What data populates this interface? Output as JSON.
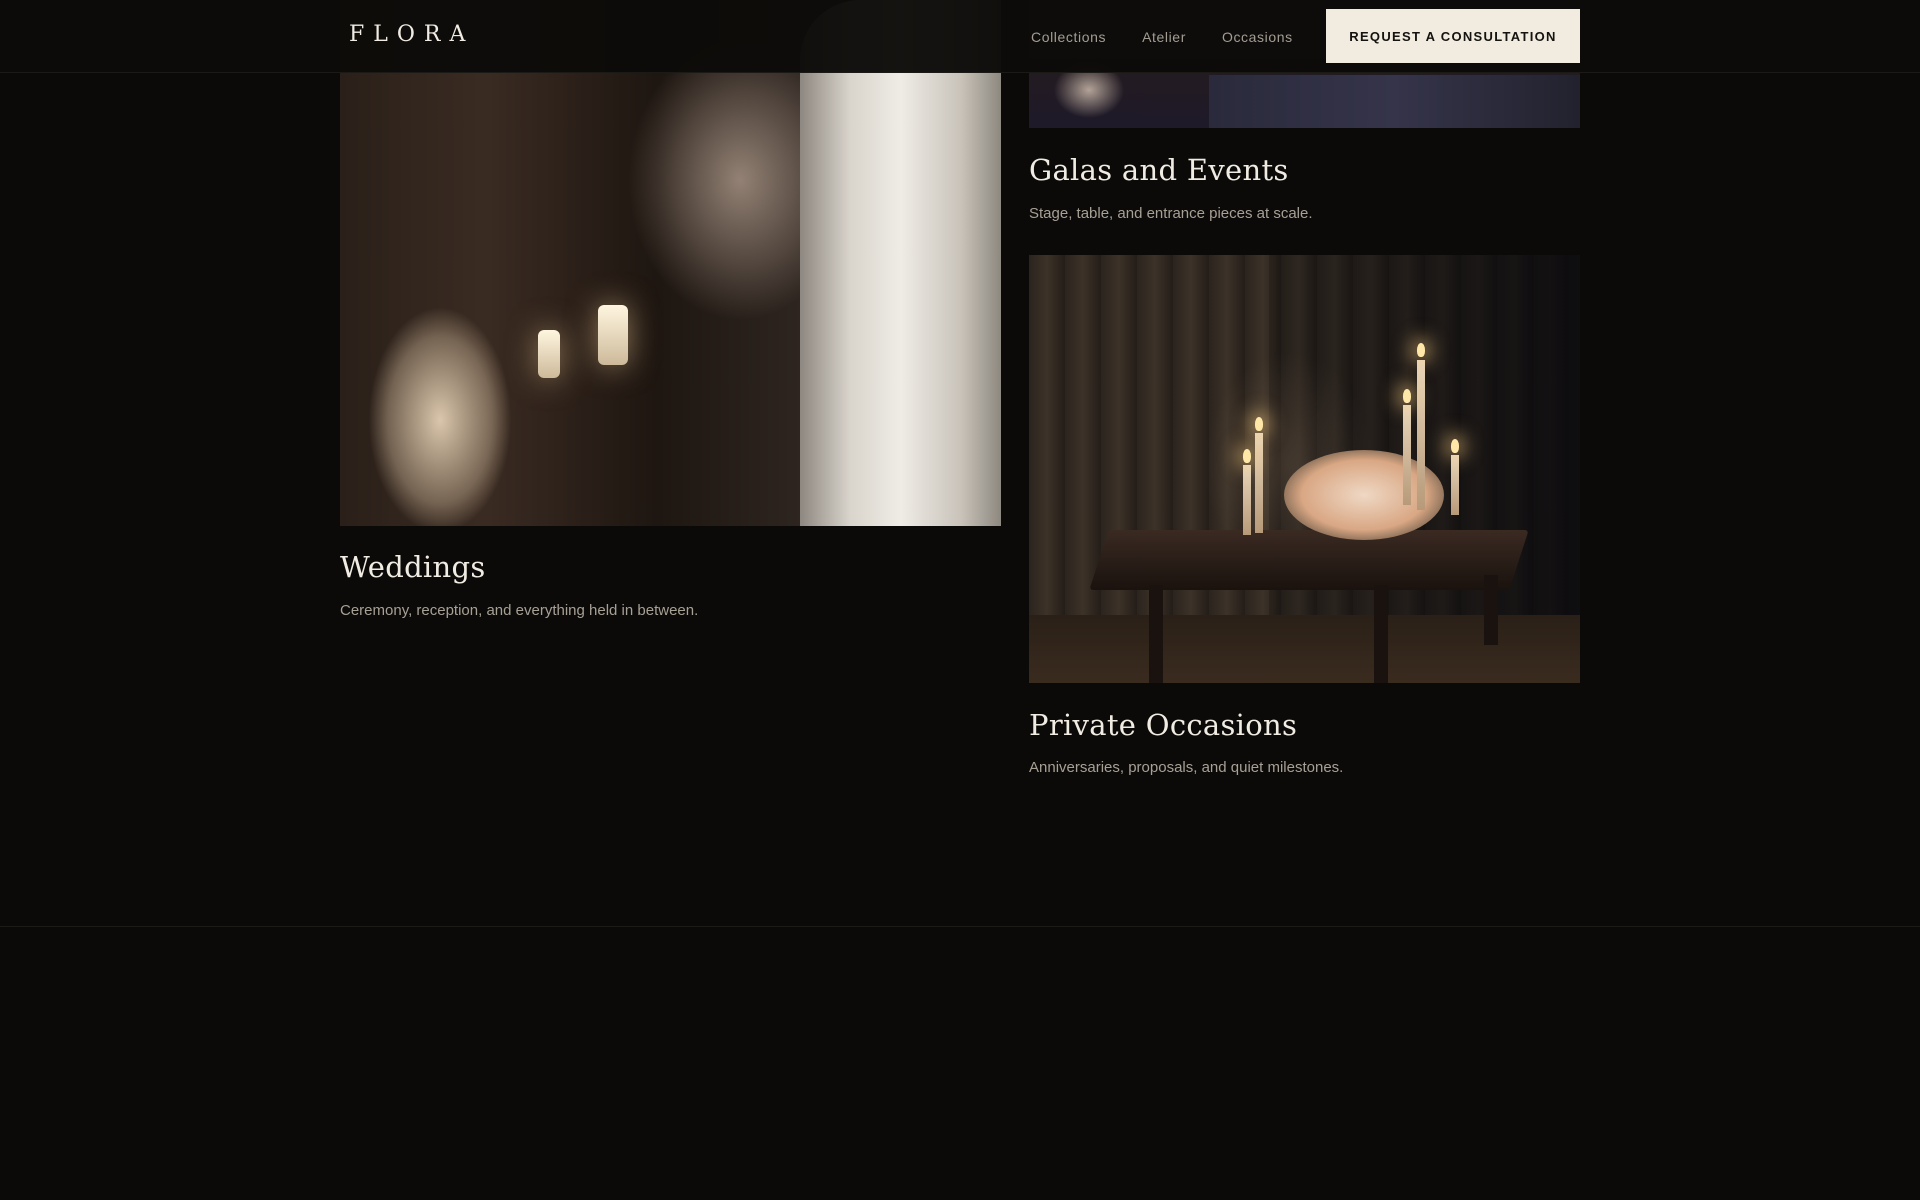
{
  "header": {
    "logo": "FLORA",
    "nav": [
      {
        "label": "Collections"
      },
      {
        "label": "Atelier"
      },
      {
        "label": "Occasions"
      }
    ],
    "cta_label": "REQUEST A CONSULTATION"
  },
  "cards": [
    {
      "title": "Weddings",
      "description": "Ceremony, reception, and everything held in between."
    },
    {
      "title": "Galas and Events",
      "description": "Stage, table, and entrance pieces at scale."
    },
    {
      "title": "Private Occasions",
      "description": "Anniversaries, proposals, and quiet milestones."
    }
  ],
  "colors": {
    "background": "#0b0a08",
    "cta_background": "#f1ebe0",
    "heading": "#f1ece3",
    "muted_text": "#a7a095"
  }
}
